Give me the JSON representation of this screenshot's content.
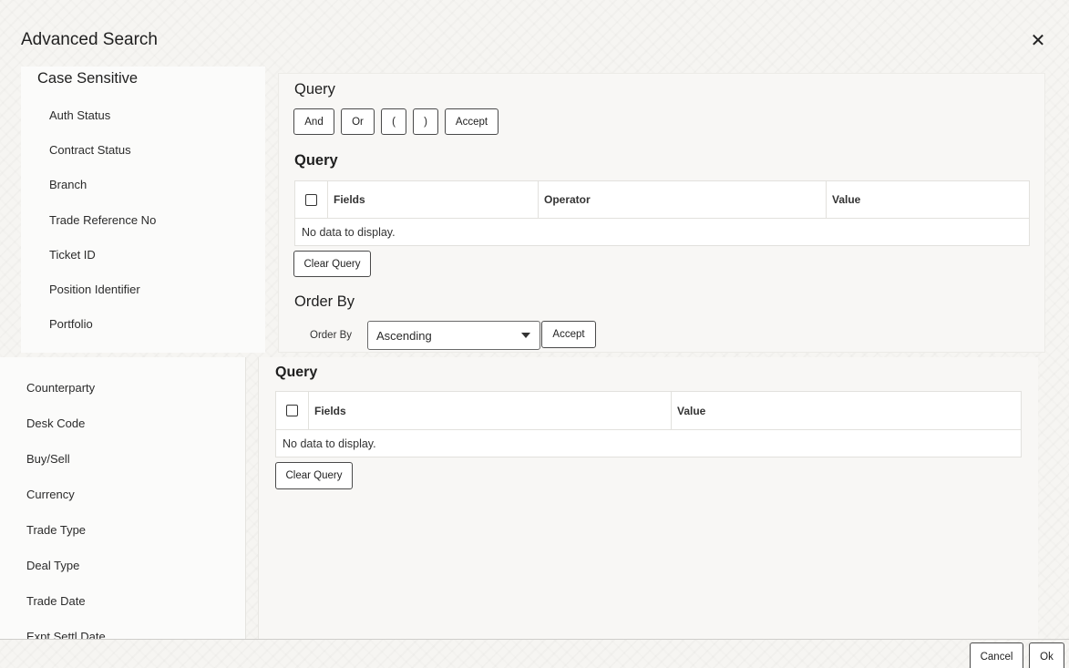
{
  "dialog": {
    "title": "Advanced Search",
    "close_icon": "close-icon"
  },
  "front_left": {
    "title": "Case Sensitive",
    "fields": [
      "Auth Status",
      "Contract Status",
      "Branch",
      "Trade Reference No",
      "Ticket ID",
      "Position Identifier",
      "Portfolio"
    ]
  },
  "front_main": {
    "query_title": "Query",
    "operators": [
      "And",
      "Or",
      "(",
      ")",
      "Accept"
    ],
    "table_title": "Query",
    "table": {
      "columns": [
        "Fields",
        "Operator",
        "Value"
      ],
      "empty_text": "No data to display."
    },
    "clear_query": "Clear Query",
    "order_by_title": "Order By",
    "order_by_label": "Order By",
    "order_by_value": "Ascending",
    "order_accept": "Accept"
  },
  "back_left": {
    "fields": [
      "Counterparty",
      "Desk Code",
      "Buy/Sell",
      "Currency",
      "Trade Type",
      "Deal Type",
      "Trade Date",
      "Expt Settl Date"
    ]
  },
  "back_main": {
    "title": "Query",
    "table": {
      "columns": [
        "Fields",
        "Value"
      ],
      "empty_text": "No data to display."
    },
    "clear_query": "Clear Query"
  },
  "footer": {
    "cancel": "Cancel",
    "ok": "Ok"
  }
}
